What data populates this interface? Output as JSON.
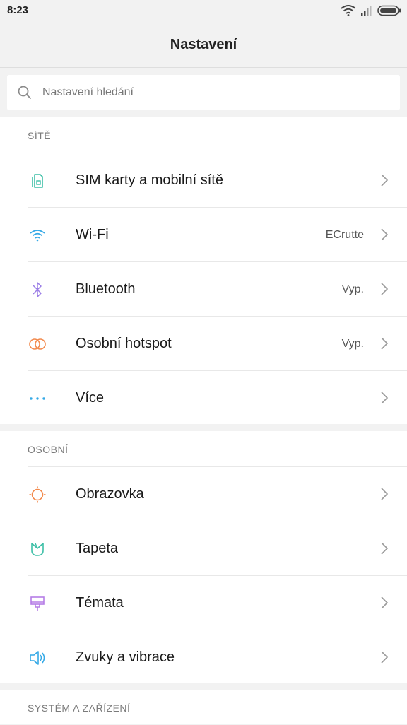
{
  "status_bar": {
    "time": "8:23",
    "icons": [
      "wifi-icon",
      "signal-icon",
      "battery-icon"
    ]
  },
  "header": {
    "title": "Nastavení"
  },
  "search": {
    "placeholder": "Nastavení hledání",
    "value": ""
  },
  "sections": [
    {
      "title": "SÍTĚ",
      "items": [
        {
          "label": "SIM karty a mobilní sítě",
          "value": "",
          "icon": "sim-card-icon",
          "color": "#3dbfa7"
        },
        {
          "label": "Wi-Fi",
          "value": "ECrutte",
          "icon": "wifi-icon",
          "color": "#35a9e6"
        },
        {
          "label": "Bluetooth",
          "value": "Vyp.",
          "icon": "bluetooth-icon",
          "color": "#9a7de6"
        },
        {
          "label": "Osobní hotspot",
          "value": "Vyp.",
          "icon": "hotspot-icon",
          "color": "#f28a4d"
        },
        {
          "label": "Více",
          "value": "",
          "icon": "more-dots-icon",
          "color": "#35a9e6"
        }
      ]
    },
    {
      "title": "OSOBNÍ",
      "items": [
        {
          "label": "Obrazovka",
          "value": "",
          "icon": "display-icon",
          "color": "#f28a4d"
        },
        {
          "label": "Tapeta",
          "value": "",
          "icon": "wallpaper-icon",
          "color": "#3dbfa7"
        },
        {
          "label": "Témata",
          "value": "",
          "icon": "themes-icon",
          "color": "#b57de6"
        },
        {
          "label": "Zvuky a vibrace",
          "value": "",
          "icon": "sound-icon",
          "color": "#35a9e6"
        }
      ]
    },
    {
      "title": "SYSTÉM A ZAŘÍZENÍ",
      "items": []
    }
  ]
}
